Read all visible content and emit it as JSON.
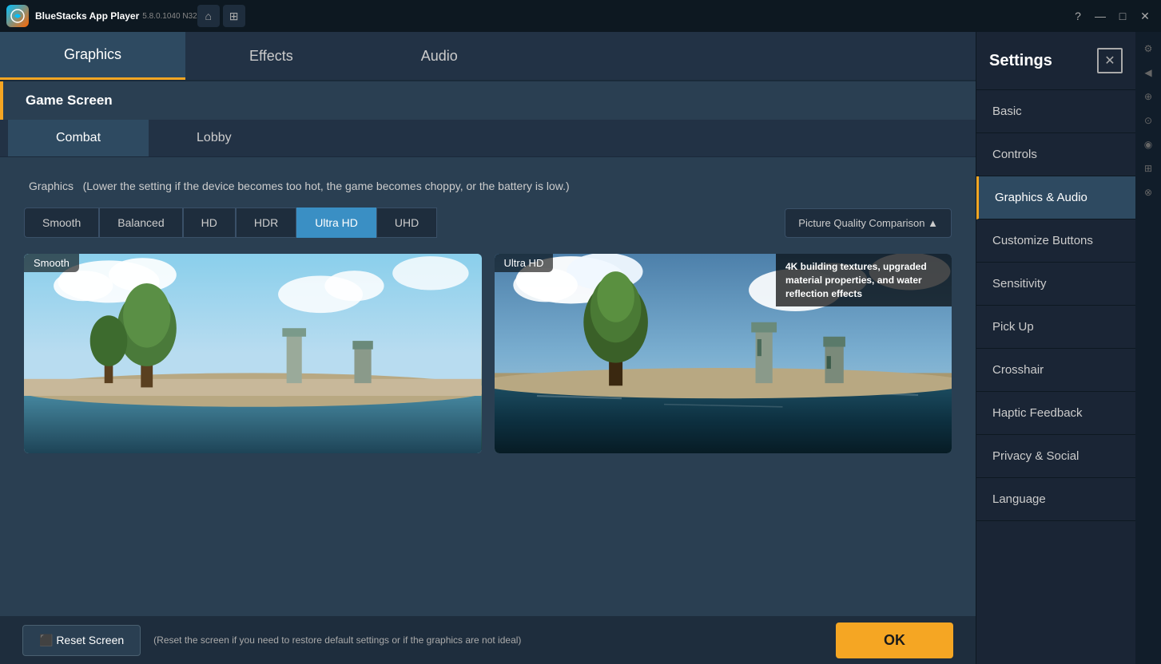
{
  "app": {
    "name": "BlueStacks App Player",
    "version": "5.8.0.1040  N32"
  },
  "titlebar": {
    "help_label": "?",
    "minimize_label": "—",
    "maximize_label": "□",
    "close_label": "✕",
    "home_label": "⌂",
    "multiinstance_label": "⊞"
  },
  "settings": {
    "title": "Settings",
    "close_label": "✕"
  },
  "top_tabs": [
    {
      "id": "graphics",
      "label": "Graphics",
      "active": true
    },
    {
      "id": "effects",
      "label": "Effects",
      "active": false
    },
    {
      "id": "audio",
      "label": "Audio",
      "active": false
    }
  ],
  "section": {
    "label": "Game Screen"
  },
  "sub_tabs": [
    {
      "id": "combat",
      "label": "Combat",
      "active": true
    },
    {
      "id": "lobby",
      "label": "Lobby",
      "active": false
    }
  ],
  "graphics_section": {
    "title": "Graphics",
    "subtitle": "(Lower the setting if the device becomes too hot, the game becomes choppy, or the battery is low.)",
    "quality_buttons": [
      {
        "id": "smooth",
        "label": "Smooth",
        "active": false
      },
      {
        "id": "balanced",
        "label": "Balanced",
        "active": false
      },
      {
        "id": "hd",
        "label": "HD",
        "active": false
      },
      {
        "id": "hdr",
        "label": "HDR",
        "active": false
      },
      {
        "id": "ultrahd",
        "label": "Ultra HD",
        "active": true
      },
      {
        "id": "uhd",
        "label": "UHD",
        "active": false
      }
    ],
    "picture_quality_btn": "Picture Quality Comparison ▲",
    "comparison": {
      "left_label": "Smooth",
      "right_label": "Ultra HD",
      "right_desc": "4K building textures, upgraded material properties, and water reflection effects"
    }
  },
  "bottom_bar": {
    "reset_label": "⬛ Reset Screen",
    "reset_hint": "(Reset the screen if you need to restore default settings or if the graphics are not ideal)",
    "ok_label": "OK"
  },
  "sidebar": {
    "items": [
      {
        "id": "basic",
        "label": "Basic",
        "active": false
      },
      {
        "id": "controls",
        "label": "Controls",
        "active": false
      },
      {
        "id": "graphics-audio",
        "label": "Graphics & Audio",
        "active": true
      },
      {
        "id": "customize-buttons",
        "label": "Customize Buttons",
        "active": false
      },
      {
        "id": "sensitivity",
        "label": "Sensitivity",
        "active": false
      },
      {
        "id": "pick-up",
        "label": "Pick Up",
        "active": false
      },
      {
        "id": "crosshair",
        "label": "Crosshair",
        "active": false
      },
      {
        "id": "haptic-feedback",
        "label": "Haptic Feedback",
        "active": false
      },
      {
        "id": "privacy-social",
        "label": "Privacy & Social",
        "active": false
      },
      {
        "id": "language",
        "label": "Language",
        "active": false
      }
    ]
  },
  "far_right_icons": [
    "⚙",
    "◀",
    "⊕",
    "⊙",
    "◉",
    "⊞",
    "⊗"
  ]
}
